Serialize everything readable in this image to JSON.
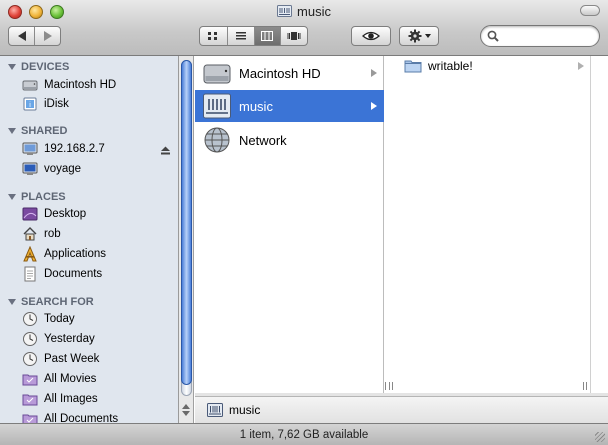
{
  "window": {
    "title": "music",
    "status": "1 item, 7,62 GB available"
  },
  "toolbar": {
    "back_icon": "back-arrow-icon",
    "forward_icon": "forward-arrow-icon",
    "views": [
      "icon-view-icon",
      "list-view-icon",
      "column-view-icon",
      "coverflow-view-icon"
    ],
    "active_view": "column",
    "quicklook_icon": "eye-icon",
    "action_icon": "gear-icon",
    "search": {
      "value": "",
      "placeholder": ""
    }
  },
  "sidebar": {
    "devices": {
      "heading": "DEVICES",
      "items": [
        {
          "label": "Macintosh HD",
          "icon": "hard-drive-icon"
        },
        {
          "label": "iDisk",
          "icon": "idisk-icon"
        }
      ]
    },
    "shared": {
      "heading": "SHARED",
      "items": [
        {
          "label": "192.168.2.7",
          "icon": "server-icon"
        },
        {
          "label": "voyage",
          "icon": "computer-icon"
        }
      ]
    },
    "places": {
      "heading": "PLACES",
      "items": [
        {
          "label": "Desktop",
          "icon": "desktop-icon"
        },
        {
          "label": "rob",
          "icon": "home-icon"
        },
        {
          "label": "Applications",
          "icon": "applications-icon"
        },
        {
          "label": "Documents",
          "icon": "documents-icon"
        }
      ]
    },
    "search_for": {
      "heading": "SEARCH FOR",
      "items": [
        {
          "label": "Today",
          "icon": "clock-icon"
        },
        {
          "label": "Yesterday",
          "icon": "clock-icon"
        },
        {
          "label": "Past Week",
          "icon": "clock-icon"
        },
        {
          "label": "All Movies",
          "icon": "smart-folder-icon"
        },
        {
          "label": "All Images",
          "icon": "smart-folder-icon"
        },
        {
          "label": "All Documents",
          "icon": "smart-folder-icon"
        }
      ]
    }
  },
  "columns": {
    "col1": [
      {
        "label": "Macintosh HD",
        "icon": "hard-drive-icon",
        "selected": false
      },
      {
        "label": "music",
        "icon": "network-volume-icon",
        "selected": true
      },
      {
        "label": "Network",
        "icon": "network-globe-icon",
        "selected": false
      }
    ],
    "col2": [
      {
        "label": "writable!",
        "icon": "folder-icon"
      }
    ]
  },
  "pathbar": {
    "label": "music",
    "icon": "network-volume-icon"
  },
  "colors": {
    "selection": "#3b74d6",
    "sidebar_bg": "#e0e6ee",
    "heading": "#5e6674"
  }
}
